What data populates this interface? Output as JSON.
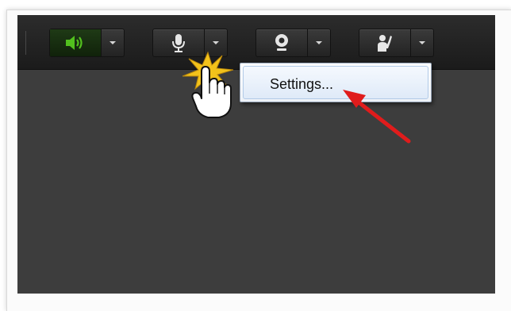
{
  "toolbar": {
    "tools": [
      {
        "name": "speaker",
        "icon": "speaker-icon",
        "active": true
      },
      {
        "name": "microphone",
        "icon": "microphone-icon",
        "active": false
      },
      {
        "name": "webcam",
        "icon": "webcam-icon",
        "active": false
      },
      {
        "name": "raise-hand",
        "icon": "raise-hand-icon",
        "active": false
      }
    ]
  },
  "menu": {
    "items": [
      {
        "label": "Settings..."
      }
    ]
  },
  "annotations": {
    "arrow_color": "#e01c1c",
    "click_burst_color": "#f2c21b",
    "speaker_active_color": "#52c11e"
  }
}
